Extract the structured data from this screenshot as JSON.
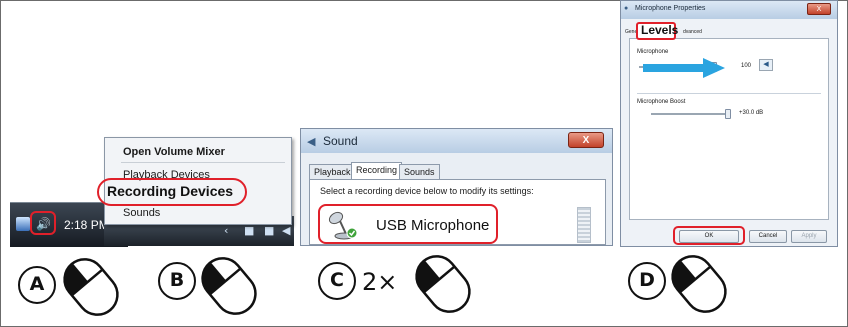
{
  "panel_a": {
    "clock": "2:18 PM",
    "volume_icon": "speaker-icon",
    "network_icon": "network-icon"
  },
  "panel_b": {
    "menu_items": [
      "Open Volume Mixer",
      "Playback Devices",
      "Recording Devices",
      "Sounds"
    ]
  },
  "panel_c": {
    "title": "Sound",
    "tabs": [
      "Playback",
      "Recording",
      "Sounds"
    ],
    "active_tab": "Recording",
    "prompt": "Select a recording device below to modify its settings:",
    "device_name": "USB Microphone",
    "device_icon": "microphone-icon",
    "close_label": "X"
  },
  "panel_d": {
    "title": "Microphone Properties",
    "tab_general_fragment": "Genera",
    "tab_active": "Levels",
    "tab_advanced_fragment": "dvanced",
    "microphone_label": "Microphone",
    "microphone_value": "100",
    "boost_label": "Microphone Boost",
    "boost_value": "+30.0 dB",
    "buttons": {
      "ok": "OK",
      "cancel": "Cancel",
      "apply": "Apply"
    },
    "close_label": "X"
  },
  "steps": [
    {
      "letter": "A",
      "prefix": "",
      "mouse_button": "left"
    },
    {
      "letter": "B",
      "prefix": "",
      "mouse_button": "left"
    },
    {
      "letter": "C",
      "prefix": "2×",
      "mouse_button": "left"
    },
    {
      "letter": "D",
      "prefix": "",
      "mouse_button": "left"
    }
  ],
  "colors": {
    "highlight": "#e0202a",
    "arrow": "#2aa4e0"
  }
}
